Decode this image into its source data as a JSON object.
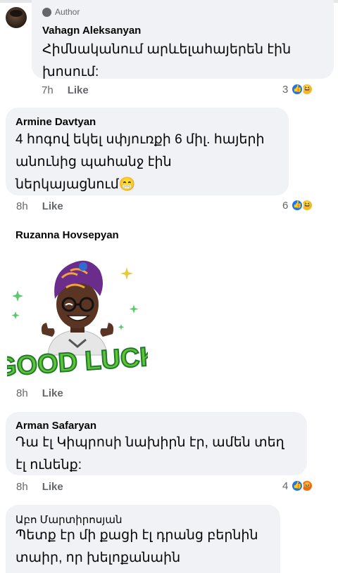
{
  "comments": [
    {
      "badge": "Author",
      "name": "Vahagn Aleksanyan",
      "text_lines": [
        "Հիմնականում արևելահայերեն էին",
        "խոսում:"
      ],
      "time": "7h",
      "like_label": "Like",
      "reaction_count": "3",
      "reactions": [
        "like-icon",
        "haha-icon"
      ]
    },
    {
      "name": "Armine Davtyan",
      "text_lines": [
        "4 հոգով եկել սփյուռքի 6 միլ. հայերի",
        "անունից պահանջ էին",
        "ներկայացնում😁"
      ],
      "time": "8h",
      "like_label": "Like",
      "reaction_count": "6",
      "reactions": [
        "like-icon",
        "haha-icon"
      ]
    },
    {
      "name": "Ruzanna Hovsepyan",
      "sticker_text": "GOOD LUCK",
      "time": "8h",
      "like_label": "Like"
    },
    {
      "name": "Arman Safaryan",
      "text_lines": [
        "Դա էլ Կիպրոսի նախիրն էր, ամեն տեղ",
        "էլ ունենք:"
      ],
      "time": "8h",
      "like_label": "Like",
      "reaction_count": "4",
      "reactions": [
        "like-icon",
        "angry-icon"
      ]
    },
    {
      "name": "Աբո Մարտիրոսյան",
      "text_lines": [
        "Պետք էր մի քացի էլ դրանց բերնին",
        "տաիր, որ խելոքանաին"
      ]
    }
  ],
  "colors": {
    "bubble": "#f0f2f5",
    "like_blue": "#1877f2",
    "haha_yellow": "#f7b928",
    "angry_orange": "#e9710f",
    "meta_gray": "#65676b",
    "sticker_green": "#5fc43a"
  }
}
